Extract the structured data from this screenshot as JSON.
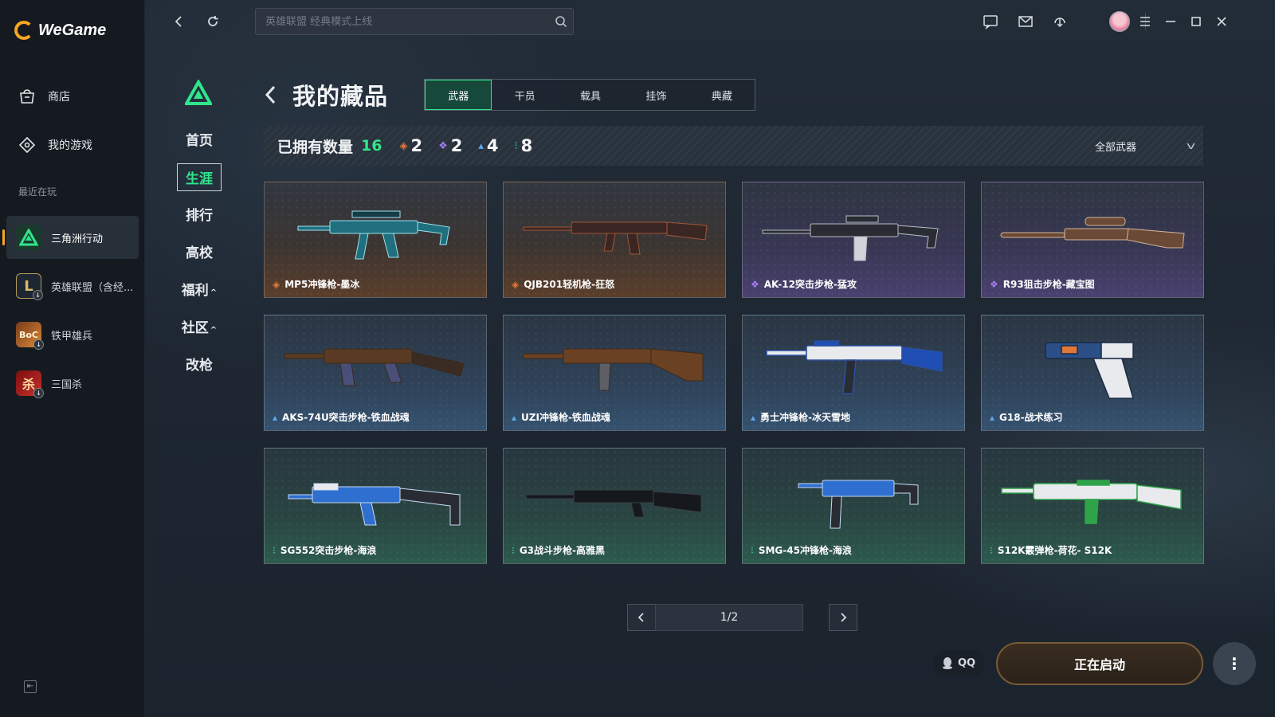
{
  "app": {
    "name": "WeGame"
  },
  "sidebar": {
    "nav": [
      {
        "label": "商店",
        "icon": "shop-icon"
      },
      {
        "label": "我的游戏",
        "icon": "my-games-icon"
      }
    ],
    "recent_label": "最近在玩",
    "recent_games": [
      {
        "label": "三角洲行动",
        "icon": "delta-force-icon",
        "active": true
      },
      {
        "label": "英雄联盟（含经...",
        "icon": "lol-icon",
        "active": false
      },
      {
        "label": "铁甲雄兵",
        "icon": "boc-icon",
        "active": false
      },
      {
        "label": "三国杀",
        "icon": "sanguosha-icon",
        "active": false
      }
    ]
  },
  "topbar": {
    "search_placeholder": "英雄联盟 经典模式上线"
  },
  "game_nav": {
    "items": [
      {
        "label": "首页"
      },
      {
        "label": "生涯",
        "active": true
      },
      {
        "label": "排行"
      },
      {
        "label": "高校"
      },
      {
        "label": "福利",
        "caret": "^"
      },
      {
        "label": "社区",
        "caret": "^"
      },
      {
        "label": "改枪"
      }
    ]
  },
  "collection": {
    "title": "我的藏品",
    "tabs": [
      {
        "label": "武器",
        "active": true
      },
      {
        "label": "干员"
      },
      {
        "label": "载具"
      },
      {
        "label": "挂饰"
      },
      {
        "label": "典藏"
      }
    ],
    "owned_label": "已拥有数量",
    "owned_count": "16",
    "rarity_counts": [
      {
        "tier": "orange",
        "count": "2"
      },
      {
        "tier": "purple",
        "count": "2"
      },
      {
        "tier": "blue",
        "count": "4"
      },
      {
        "tier": "green",
        "count": "8"
      }
    ],
    "filter_label": "全部武器",
    "items": [
      {
        "name": "MP5冲锋枪-墨冰",
        "tier": "orange"
      },
      {
        "name": "QJB201轻机枪-狂怒",
        "tier": "orange"
      },
      {
        "name": "AK-12突击步枪-猛攻",
        "tier": "purple"
      },
      {
        "name": "R93狙击步枪-藏宝图",
        "tier": "purple"
      },
      {
        "name": "AKS-74U突击步枪-铁血战魂",
        "tier": "blue"
      },
      {
        "name": "UZI冲锋枪-铁血战魂",
        "tier": "blue"
      },
      {
        "name": "勇士冲锋枪-冰天雪地",
        "tier": "blue"
      },
      {
        "name": "G18-战术练习",
        "tier": "blue"
      },
      {
        "name": "SG552突击步枪-海浪",
        "tier": "green"
      },
      {
        "name": "G3战斗步枪-高雅黑",
        "tier": "green"
      },
      {
        "name": "SMG-45冲锋枪-海浪",
        "tier": "green"
      },
      {
        "name": "S12K霰弹枪-荷花- S12K",
        "tier": "green"
      }
    ],
    "pagination": "1/2"
  },
  "footer": {
    "qq_label": "QQ",
    "launch_label": "正在启动"
  },
  "colors": {
    "accent_green": "#2fe68c",
    "tier_orange": "#e87a3a",
    "tier_purple": "#a57cf0",
    "tier_blue": "#5fa7ea",
    "tier_green": "#36d79b"
  }
}
